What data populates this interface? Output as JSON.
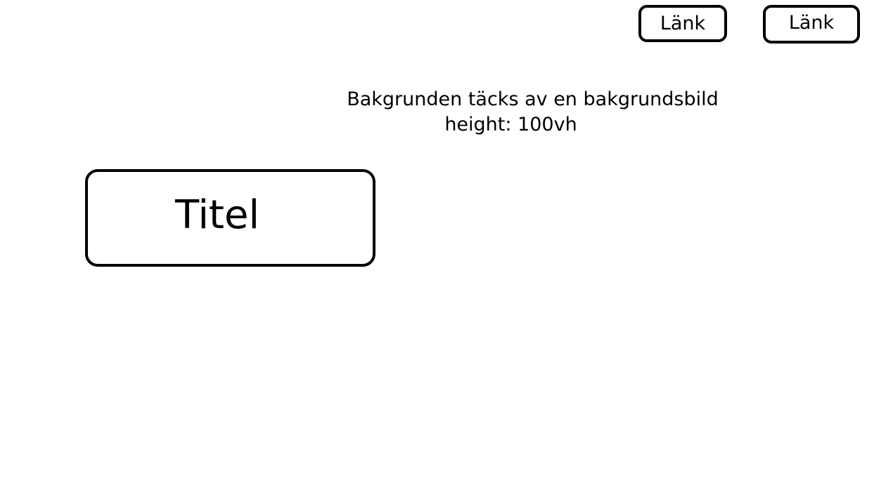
{
  "nav": {
    "links": [
      {
        "label": "Länk"
      },
      {
        "label": "Länk"
      }
    ]
  },
  "note": {
    "line1": "Bakgrunden täcks av en bakgrundsbild",
    "line2": "height: 100vh"
  },
  "hero": {
    "title": "Titel"
  }
}
